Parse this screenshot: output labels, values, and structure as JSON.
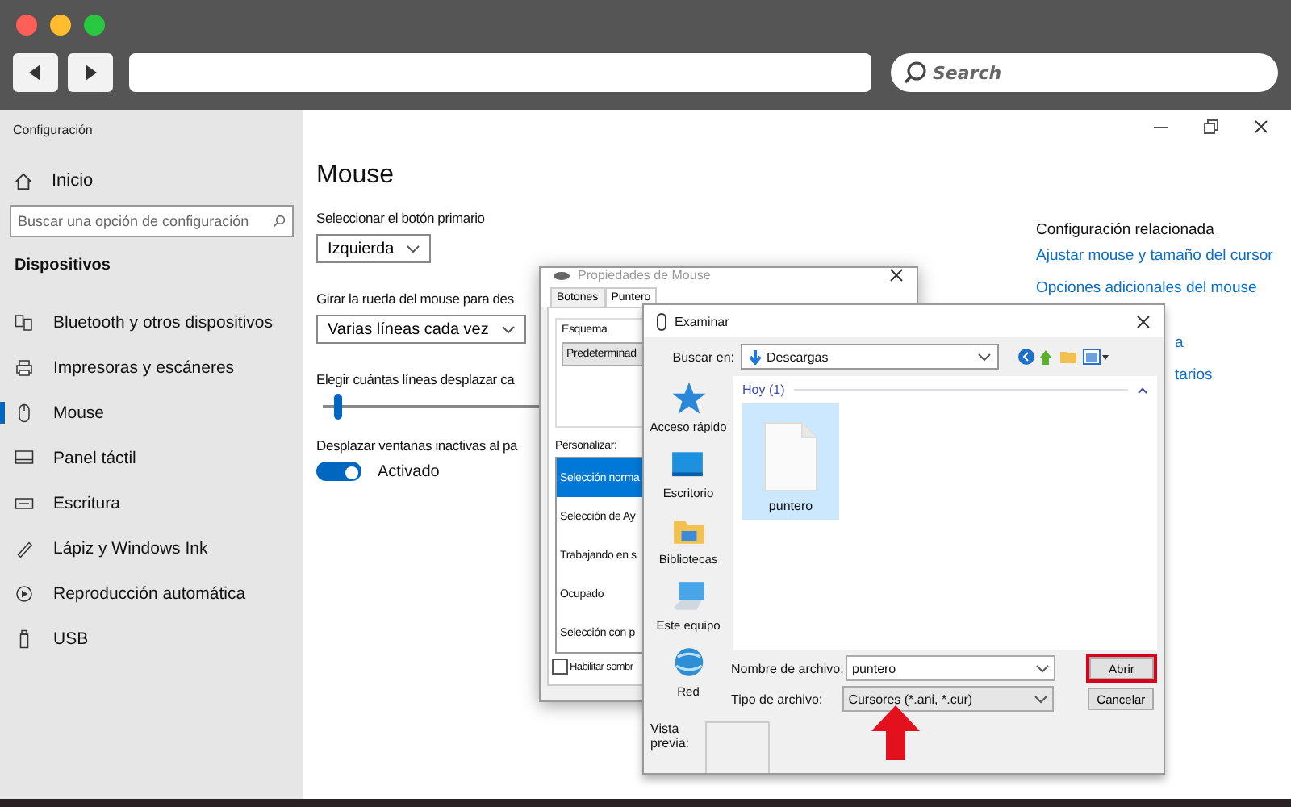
{
  "browser": {
    "search": {
      "placeholder": "Search"
    }
  },
  "settings": {
    "title": "Configuración",
    "home": "Inicio",
    "search": {
      "placeholder": "Buscar una opción de configuración"
    },
    "section": "Dispositivos",
    "items": [
      {
        "label": "Bluetooth y otros dispositivos",
        "selected": false
      },
      {
        "label": "Impresoras y escáneres",
        "selected": false
      },
      {
        "label": "Mouse",
        "selected": true
      },
      {
        "label": "Panel táctil",
        "selected": false
      },
      {
        "label": "Escritura",
        "selected": false
      },
      {
        "label": "Lápiz y Windows Ink",
        "selected": false
      },
      {
        "label": "Reproducción automática",
        "selected": false
      },
      {
        "label": "USB",
        "selected": false
      }
    ],
    "page_title": "Mouse",
    "controls": [
      {
        "kind": "dropdown",
        "label": "Seleccionar el botón primario",
        "value": "Izquierda"
      },
      {
        "kind": "dropdown",
        "label": "Girar la rueda del mouse para des",
        "value": "Varias líneas cada vez"
      },
      {
        "kind": "slider",
        "label": "Elegir cuántas líneas desplazar ca",
        "level": 0.03
      },
      {
        "kind": "toggle",
        "label": "Desplazar ventanas inactivas al pa",
        "on": true,
        "state": "Activado"
      }
    ],
    "related": {
      "title": "Configuración relacionada",
      "links": [
        "Ajustar mouse y tamaño del cursor",
        "Opciones adicionales del mouse"
      ],
      "cut_links": [
        "a",
        "tarios"
      ]
    }
  },
  "mouse_properties": {
    "title": "Propiedades de Mouse",
    "tabs": [
      {
        "label": "Botones",
        "selected": false
      },
      {
        "label": "Puntero",
        "selected": true
      }
    ],
    "scheme_label": "Esquema",
    "scheme_value": "Predeterminad",
    "customize_label": "Personalizar:",
    "pointers": [
      {
        "label": "Selección norma",
        "selected": true
      },
      {
        "label": "Selección de Ay",
        "selected": false
      },
      {
        "label": "Trabajando en s",
        "selected": false
      },
      {
        "label": "Ocupado",
        "selected": false
      },
      {
        "label": "Selección con p",
        "selected": false
      }
    ],
    "shadow": {
      "label": "Habilitar sombr",
      "checked": false
    }
  },
  "browse_dialog": {
    "title": "Examinar",
    "look_in_label": "Buscar en:",
    "look_in_value": "Descargas",
    "places": [
      "Acceso rápido",
      "Escritorio",
      "Bibliotecas",
      "Este equipo",
      "Red"
    ],
    "group": "Hoy (1)",
    "files": [
      {
        "name": "puntero",
        "selected": true
      }
    ],
    "filename_label": "Nombre de archivo:",
    "filename_value": "puntero",
    "filetype_label": "Tipo de archivo:",
    "filetype_value": "Cursores (*.ani, *.cur)",
    "buttons": [
      {
        "label": "Abrir",
        "highlighted": true
      },
      {
        "label": "Cancelar",
        "highlighted": false
      }
    ],
    "preview_label": "Vista previa:"
  },
  "annotations": [
    {
      "kind": "arrow"
    }
  ]
}
